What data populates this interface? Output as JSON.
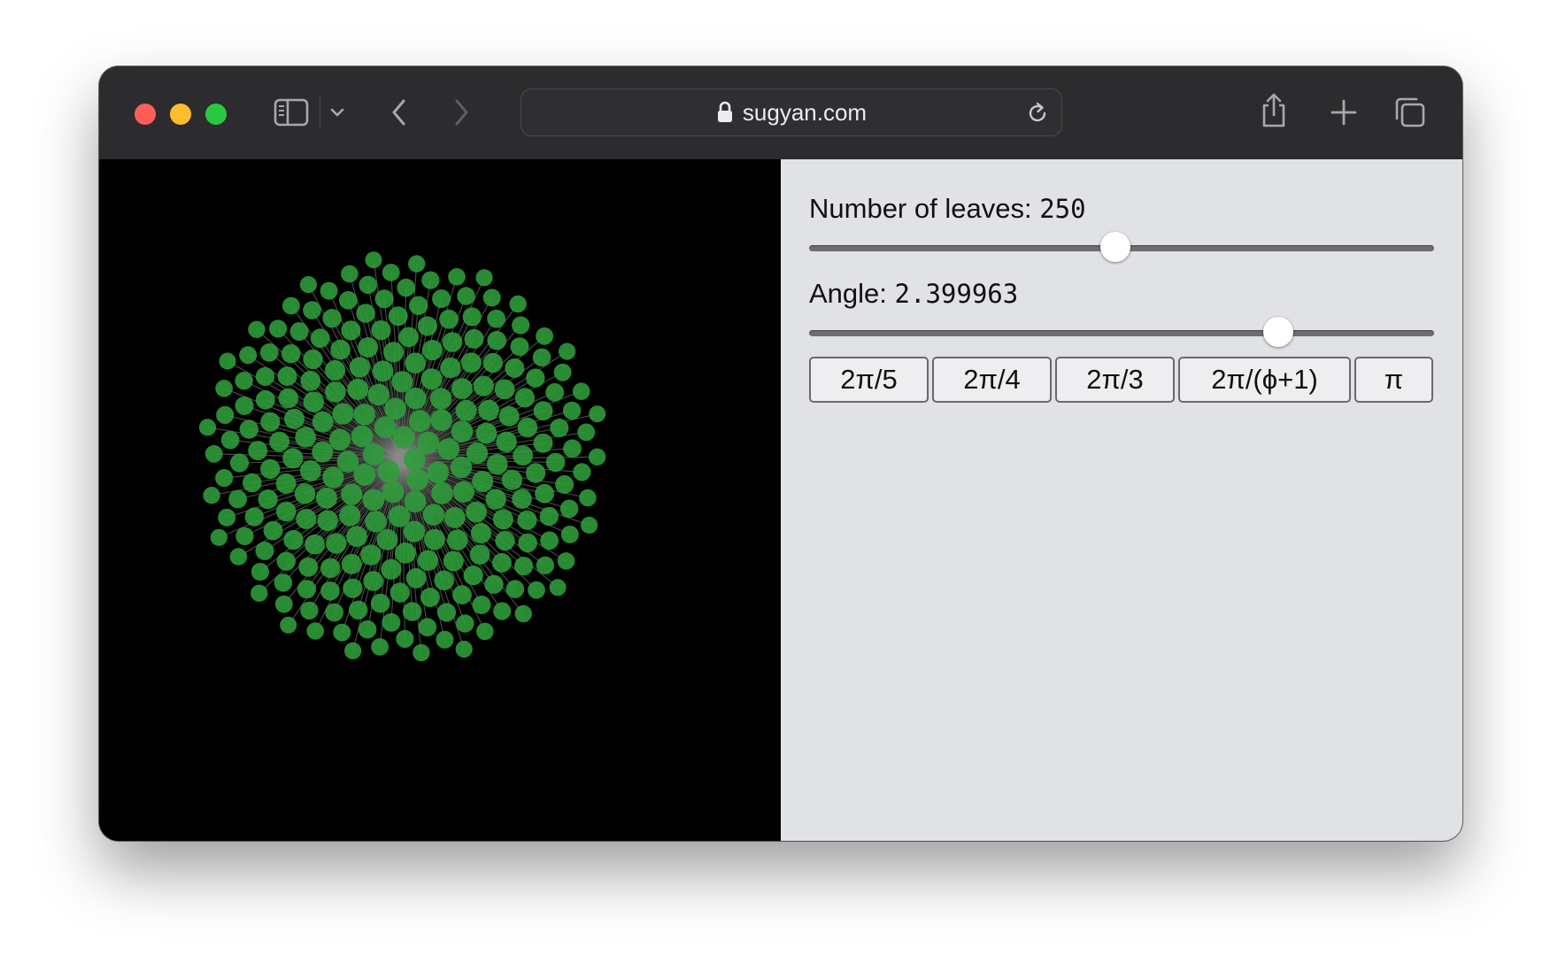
{
  "browser": {
    "url": "sugyan.com"
  },
  "controls": {
    "leaves": {
      "label": "Number of leaves:",
      "value": "250",
      "slider_fraction": 0.49
    },
    "angle": {
      "label": "Angle:",
      "value": "2.399963",
      "slider_fraction": 0.75
    },
    "presets": [
      "2π/5",
      "2π/4",
      "2π/3",
      "2π/(ϕ+1)",
      "π"
    ]
  },
  "phyllotaxis": {
    "leaf_count": 250,
    "angle": 2.399963,
    "leaf_color": "#2f9e3a",
    "stem_color": "#8a8a8a",
    "background": "#000000"
  }
}
